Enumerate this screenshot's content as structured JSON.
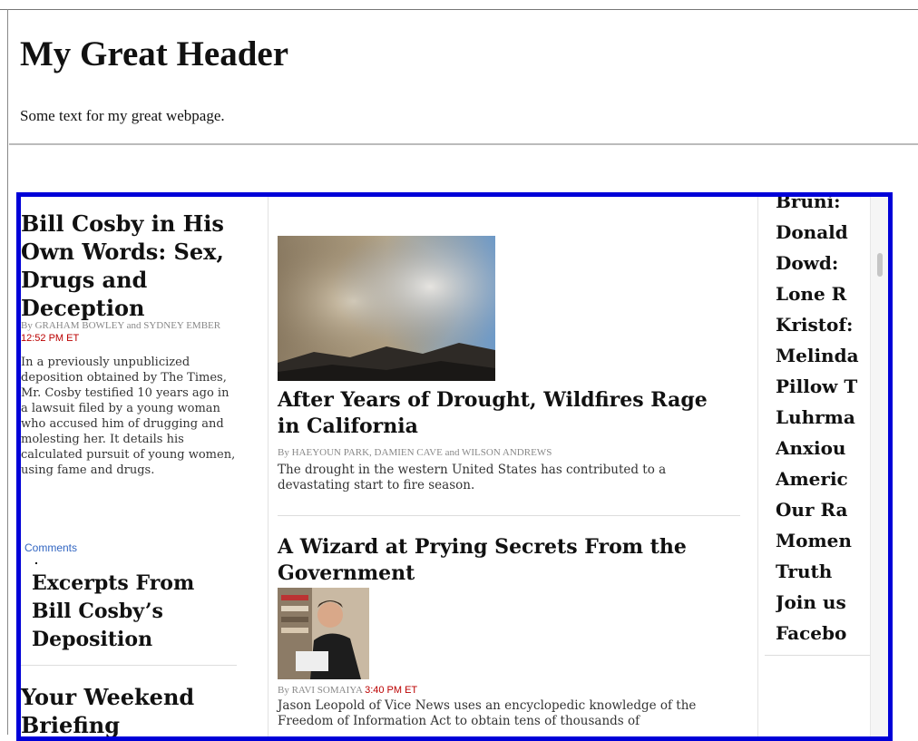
{
  "page": {
    "title": "My Great Header",
    "text": "Some text for my great webpage."
  },
  "lead": {
    "title": "Bill Cosby in His Own Words: Sex, Drugs and Deception",
    "byline": "By GRAHAM BOWLEY and SYDNEY EMBER",
    "time": "12:52 PM ET",
    "summary": "In a previously unpublicized deposition obtained by The Times, Mr. Cosby testified 10 years ago in a lawsuit filed by a young woman who accused him of drugging and molesting her. It details his calculated pursuit of young women, using fame and drugs.",
    "comments": "Comments",
    "related": "Excerpts From Bill Cosby’s Deposition"
  },
  "briefing": {
    "title": "Your Weekend Briefing"
  },
  "middle": {
    "story1": {
      "title": "After Years of Drought, Wildfires Rage in California",
      "byline": "By HAEYOUN PARK, DAMIEN CAVE and WILSON ANDREWS",
      "summary": "The drought in the western United States has contributed to a devastating start to fire season."
    },
    "story2": {
      "title": "A Wizard at Prying Secrets From the Government",
      "byline": "By RAVI SOMAIYA",
      "time": "3:40 PM ET",
      "summary": "Jason Leopold of Vice News uses an encyclopedic knowledge of the Freedom of Information Act to obtain tens of thousands of"
    }
  },
  "right": {
    "items": [
      "Bruni: ",
      "Donald",
      "Dowd: ",
      "Lone R",
      "Kristof:",
      "Melinda",
      "Pillow T",
      "Luhrma",
      "Anxiou",
      "Americ",
      "Our Ra",
      "Momen",
      "Truth",
      "Join us",
      "Facebo"
    ]
  },
  "colors": {
    "frame_border": "#0000d8",
    "time_red": "#b00000",
    "link_blue": "#3266c2"
  }
}
